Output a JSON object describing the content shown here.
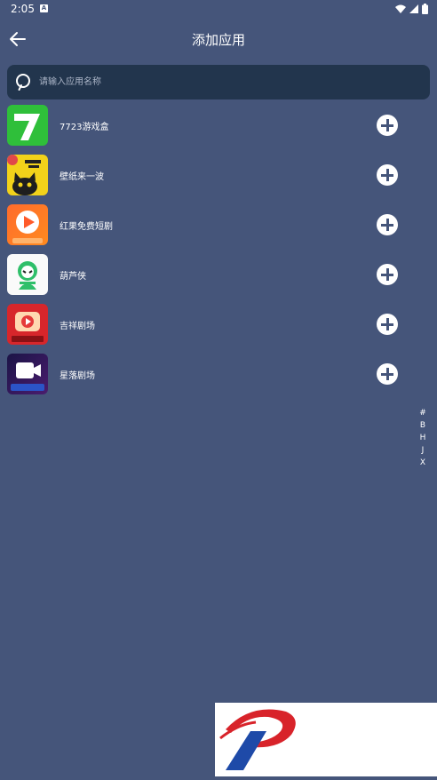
{
  "status": {
    "time": "2:05",
    "notification_glyph": "A"
  },
  "header": {
    "title": "添加应用"
  },
  "search": {
    "placeholder": "请输入应用名称",
    "value": ""
  },
  "apps": [
    {
      "name": "7723游戏盒"
    },
    {
      "name": "壁纸来一波"
    },
    {
      "name": "红果免费短剧"
    },
    {
      "name": "葫芦侠"
    },
    {
      "name": "吉祥剧场"
    },
    {
      "name": "星落剧场"
    }
  ],
  "index_letters": [
    "#",
    "B",
    "H",
    "J",
    "X"
  ],
  "colors": {
    "background": "#45557a",
    "search_bg": "#22354d",
    "text": "#ffffff"
  },
  "icons": [
    "back-arrow-icon",
    "search-icon",
    "plus-circle-icon",
    "wifi-icon",
    "signal-icon",
    "battery-icon"
  ]
}
